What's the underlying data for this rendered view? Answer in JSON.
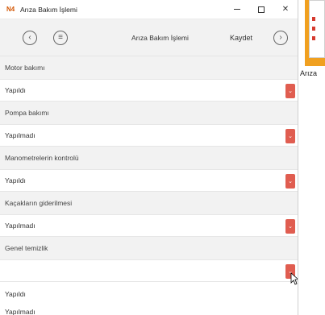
{
  "window": {
    "app_icon": "N4",
    "title": "Arıza Bakım İşlemi",
    "controls": [
      "minimize-icon",
      "maximize-icon",
      "close-icon"
    ]
  },
  "toolbar": {
    "title": "Arıza Bakım İşlemi",
    "save_label": "Kaydet",
    "back_icon": "chevron-left-icon",
    "menu_icon": "menu-icon",
    "forward_icon": "chevron-right-icon"
  },
  "fields": [
    {
      "label": "Motor bakımı",
      "value": "Yapıldı"
    },
    {
      "label": "Pompa bakımı",
      "value": "Yapılmadı"
    },
    {
      "label": "Manometrelerin kontrolü",
      "value": "Yapıldı"
    },
    {
      "label": "Kaçakların giderilmesi",
      "value": "Yapılmadı"
    },
    {
      "label": "Genel temizlik",
      "value": ""
    }
  ],
  "dropdown_options": [
    "Yapıldı",
    "Yapılmadı"
  ],
  "desktop": {
    "label": "i Arıza"
  },
  "colors": {
    "accent": "#e05d50",
    "label_bg": "#f2f2f2",
    "tile": "#f0a020"
  }
}
